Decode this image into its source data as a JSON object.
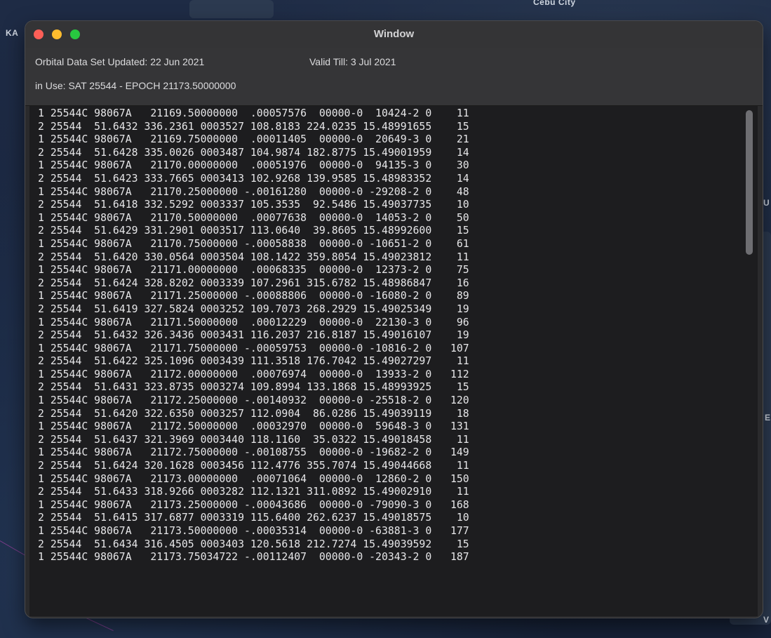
{
  "desktop": {
    "labels": {
      "ka": "KA",
      "city": "Cebu City",
      "u": "U",
      "e": "E",
      "v": "V"
    }
  },
  "window": {
    "title": "Window",
    "orbital_updated": "Orbital Data Set Updated:  22 Jun 2021",
    "valid_till": "Valid Till:  3 Jul 2021",
    "in_use": "in Use:  SAT 25544  -  EPOCH 21173.50000000"
  },
  "tle_lines": [
    "1 25544C 98067A   21169.50000000  .00057576  00000-0  10424-2 0    11",
    "2 25544  51.6432 336.2361 0003527 108.8183 224.0235 15.48991655    15",
    "1 25544C 98067A   21169.75000000  .00011405  00000-0  20649-3 0    21",
    "2 25544  51.6428 335.0026 0003487 104.9874 182.8775 15.49001959    14",
    "1 25544C 98067A   21170.00000000  .00051976  00000-0  94135-3 0    30",
    "2 25544  51.6423 333.7665 0003413 102.9268 139.9585 15.48983352    14",
    "1 25544C 98067A   21170.25000000 -.00161280  00000-0 -29208-2 0    48",
    "2 25544  51.6418 332.5292 0003337 105.3535  92.5486 15.49037735    10",
    "1 25544C 98067A   21170.50000000  .00077638  00000-0  14053-2 0    50",
    "2 25544  51.6429 331.2901 0003517 113.0640  39.8605 15.48992600    15",
    "1 25544C 98067A   21170.75000000 -.00058838  00000-0 -10651-2 0    61",
    "2 25544  51.6420 330.0564 0003504 108.1422 359.8054 15.49023812    11",
    "1 25544C 98067A   21171.00000000  .00068335  00000-0  12373-2 0    75",
    "2 25544  51.6424 328.8202 0003339 107.2961 315.6782 15.48986847    16",
    "1 25544C 98067A   21171.25000000 -.00088806  00000-0 -16080-2 0    89",
    "2 25544  51.6419 327.5824 0003252 109.7073 268.2929 15.49025349    19",
    "1 25544C 98067A   21171.50000000  .00012229  00000-0  22130-3 0    96",
    "2 25544  51.6432 326.3436 0003431 116.2037 216.8187 15.49016107    19",
    "1 25544C 98067A   21171.75000000 -.00059753  00000-0 -10816-2 0   107",
    "2 25544  51.6422 325.1096 0003439 111.3518 176.7042 15.49027297    11",
    "1 25544C 98067A   21172.00000000  .00076974  00000-0  13933-2 0   112",
    "2 25544  51.6431 323.8735 0003274 109.8994 133.1868 15.48993925    15",
    "1 25544C 98067A   21172.25000000 -.00140932  00000-0 -25518-2 0   120",
    "2 25544  51.6420 322.6350 0003257 112.0904  86.0286 15.49039119    18",
    "1 25544C 98067A   21172.50000000  .00032970  00000-0  59648-3 0   131",
    "2 25544  51.6437 321.3969 0003440 118.1160  35.0322 15.49018458    11",
    "1 25544C 98067A   21172.75000000 -.00108755  00000-0 -19682-2 0   149",
    "2 25544  51.6424 320.1628 0003456 112.4776 355.7074 15.49044668    11",
    "1 25544C 98067A   21173.00000000  .00071064  00000-0  12860-2 0   150",
    "2 25544  51.6433 318.9266 0003282 112.1321 311.0892 15.49002910    11",
    "1 25544C 98067A   21173.25000000 -.00043686  00000-0 -79090-3 0   168",
    "2 25544  51.6415 317.6877 0003319 115.6400 262.6237 15.49018575    10",
    "1 25544C 98067A   21173.50000000 -.00035314  00000-0 -63881-3 0   177",
    "2 25544  51.6434 316.4505 0003403 120.5618 212.7274 15.49039592    15",
    "1 25544C 98067A   21173.75034722 -.00112407  00000-0 -20343-2 0   187"
  ]
}
